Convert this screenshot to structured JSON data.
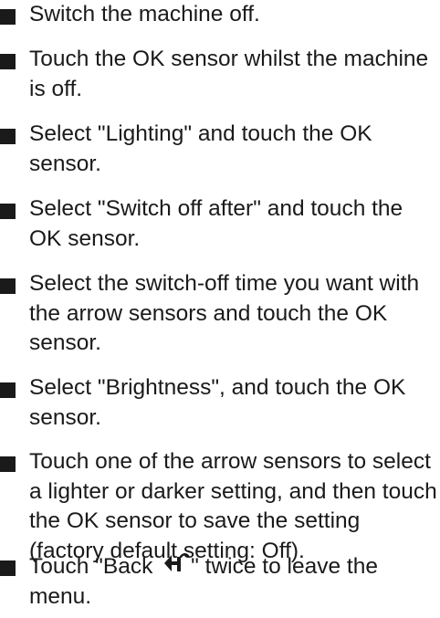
{
  "steps": [
    {
      "text": "Switch the machine off."
    },
    {
      "text": "Touch the OK sensor whilst the machine is off."
    },
    {
      "text": "Select \"Lighting\" and touch the OK sensor."
    },
    {
      "text": "Select \"Switch off after\" and touch the OK sensor."
    },
    {
      "text": "Select the switch-off time you want with the arrow sensors and touch the OK sensor."
    },
    {
      "text": "Select \"Brightness\", and touch the OK sensor."
    },
    {
      "text": "Touch one of the arrow sensors to select a lighter or darker setting, and then touch the OK sensor to save the setting (factory default setting: Off)."
    },
    {
      "text_before": "Touch \"Back ",
      "icon": "back-arrow-icon",
      "text_after": "\" twice to leave the menu."
    }
  ]
}
